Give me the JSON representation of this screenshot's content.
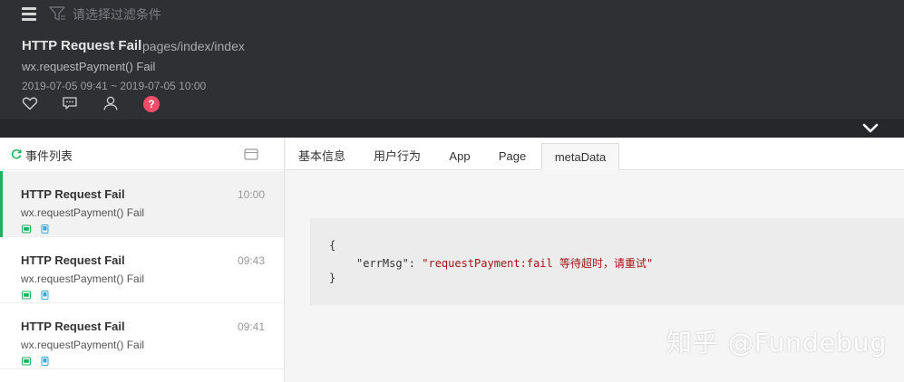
{
  "header": {
    "filter_placeholder": "请选择过滤条件",
    "title": "HTTP Request Fail",
    "page": "pages/index/index",
    "subtitle": "wx.requestPayment() Fail",
    "time_range": "2019-07-05 09:41 ~ 2019-07-05 10:00",
    "badge": "?"
  },
  "left_panel": {
    "title": "事件列表",
    "events": [
      {
        "title": "HTTP Request Fail",
        "time": "10:00",
        "subtitle": "wx.requestPayment() Fail",
        "active": true
      },
      {
        "title": "HTTP Request Fail",
        "time": "09:43",
        "subtitle": "wx.requestPayment() Fail",
        "active": false
      },
      {
        "title": "HTTP Request Fail",
        "time": "09:41",
        "subtitle": "wx.requestPayment() Fail",
        "active": false
      }
    ]
  },
  "tabs": [
    {
      "label": "基本信息"
    },
    {
      "label": "用户行为"
    },
    {
      "label": "App"
    },
    {
      "label": "Page"
    },
    {
      "label": "metaData",
      "active": true
    }
  ],
  "metadata": {
    "open_brace": "{",
    "key": "\"errMsg\"",
    "colon": ": ",
    "value": "\"requestPayment:fail 等待超时，请重试\"",
    "close_brace": "}"
  },
  "watermark": "知乎 @Fundebug",
  "colors": {
    "header_bg": "#2f3034",
    "accent_green": "#19b25a",
    "badge_red": "#f44d6a",
    "string_red": "#a31515"
  }
}
